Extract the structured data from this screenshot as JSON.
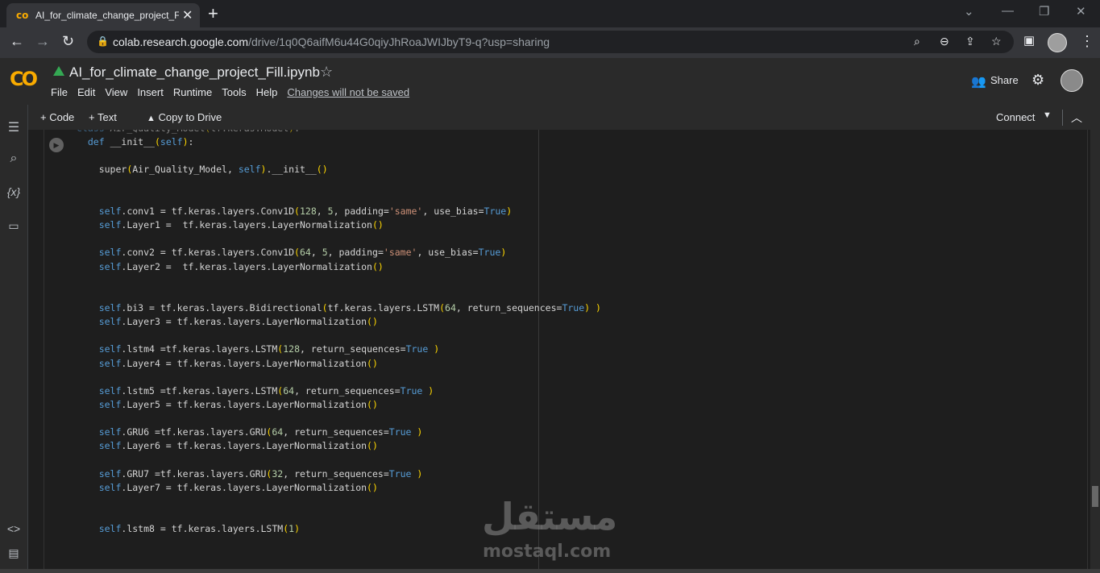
{
  "browser": {
    "tab_title": "AI_for_climate_change_project_Fi",
    "tab_favicon": "co",
    "close_glyph": "✕",
    "new_tab_glyph": "+",
    "url_host": "colab.research.google.com",
    "url_path": "/drive/1q0Q6aifM6u44G0qiyJhRoaJWIJbyT9-q?usp=sharing"
  },
  "colab": {
    "logo": "CO",
    "notebook_title": "AI_for_climate_change_project_Fill.ipynb",
    "menu": [
      "File",
      "Edit",
      "View",
      "Insert",
      "Runtime",
      "Tools",
      "Help"
    ],
    "unsaved_notice": "Changes will not be saved",
    "share_label": "Share"
  },
  "toolbar": {
    "code_label": "+ Code",
    "text_label": "+ Text",
    "copy_label": "Copy to Drive",
    "connect_label": "Connect"
  },
  "left_rail": {
    "variables_glyph": "{x}",
    "code_glyph": "<>"
  },
  "code_lines": [
    "class Air_Quality_Model(tf.keras.Model):",
    "  def __init__(self):",
    "",
    "    super(Air_Quality_Model, self).__init__()",
    "",
    "",
    "    self.conv1 = tf.keras.layers.Conv1D(128, 5, padding='same', use_bias=True)",
    "    self.Layer1 =  tf.keras.layers.LayerNormalization()",
    "",
    "    self.conv2 = tf.keras.layers.Conv1D(64, 5, padding='same', use_bias=True)",
    "    self.Layer2 =  tf.keras.layers.LayerNormalization()",
    "",
    "",
    "    self.bi3 = tf.keras.layers.Bidirectional(tf.keras.layers.LSTM(64, return_sequences=True) )",
    "    self.Layer3 = tf.keras.layers.LayerNormalization()",
    "",
    "    self.lstm4 =tf.keras.layers.LSTM(128, return_sequences=True )",
    "    self.Layer4 = tf.keras.layers.LayerNormalization()",
    "",
    "    self.lstm5 =tf.keras.layers.LSTM(64, return_sequences=True )",
    "    self.Layer5 = tf.keras.layers.LayerNormalization()",
    "",
    "    self.GRU6 =tf.keras.layers.GRU(64, return_sequences=True )",
    "    self.Layer6 = tf.keras.layers.LayerNormalization()",
    "",
    "    self.GRU7 =tf.keras.layers.GRU(32, return_sequences=True )",
    "    self.Layer7 = tf.keras.layers.LayerNormalization()",
    "",
    "",
    "    self.lstm8 = tf.keras.layers.LSTM(1)"
  ],
  "watermark": {
    "arabic": "مستقل",
    "latin": "mostaql.com"
  },
  "colors": {
    "keyword": "#569cd6",
    "number": "#b5cea8",
    "string": "#ce9178",
    "bracket": "#ffd700",
    "brand": "#f9ab00"
  }
}
